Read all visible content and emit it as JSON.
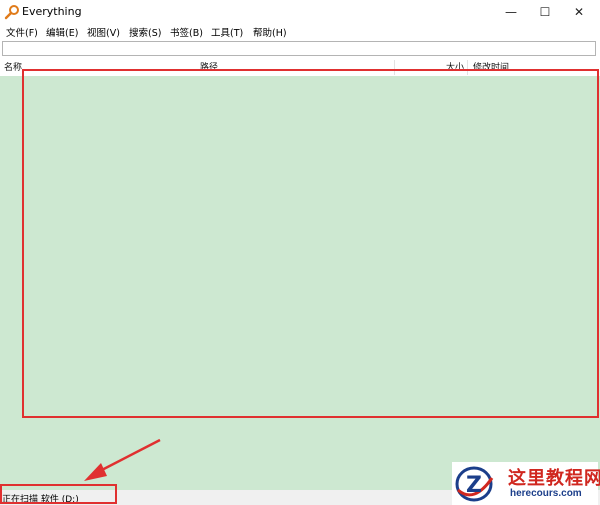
{
  "window": {
    "title": "Everything",
    "minimize_glyph": "—",
    "maximize_glyph": "☐",
    "close_glyph": "✕"
  },
  "menu": [
    "文件(F)",
    "编辑(E)",
    "视图(V)",
    "搜索(S)",
    "书签(B)",
    "工具(T)",
    "帮助(H)"
  ],
  "search": {
    "value": "",
    "placeholder": ""
  },
  "columns": {
    "name": "名称",
    "path": "路径",
    "size": "大小",
    "modified": "修改时间"
  },
  "status": {
    "text": "正在扫描 软件 (D:)"
  },
  "watermark": {
    "title": "这里教程网",
    "url": "herecours.com",
    "logo_letter": "Z"
  },
  "colors": {
    "list_background": "#cde8d1",
    "annotation_red": "#e03030",
    "watermark_red": "#d0271f",
    "watermark_blue": "#1b3e8a"
  }
}
